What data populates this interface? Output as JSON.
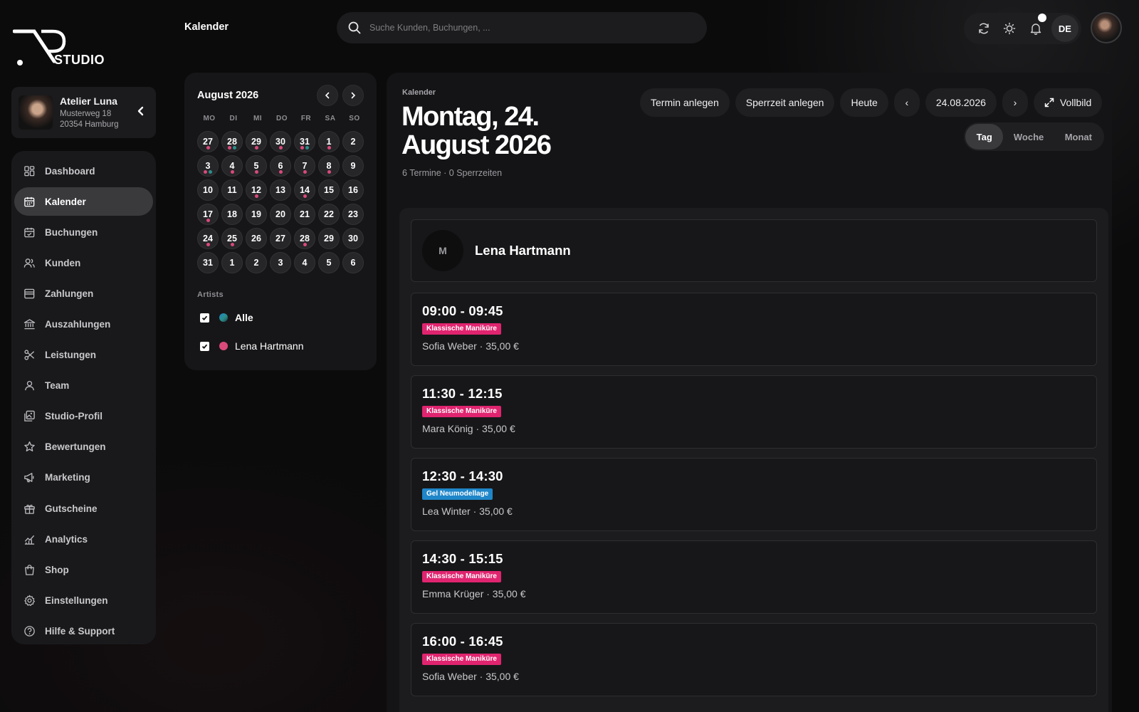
{
  "brand": {
    "name": "STUDIO"
  },
  "studio": {
    "name": "Atelier Luna",
    "street": "Musterweg 18",
    "city": "20354 Hamburg"
  },
  "nav": {
    "items": [
      {
        "label": "Dashboard",
        "icon": "dashboard-icon"
      },
      {
        "label": "Kalender",
        "icon": "calendar-icon",
        "active": true
      },
      {
        "label": "Buchungen",
        "icon": "bookings-icon"
      },
      {
        "label": "Kunden",
        "icon": "customers-icon"
      },
      {
        "label": "Zahlungen",
        "icon": "payments-icon"
      },
      {
        "label": "Auszahlungen",
        "icon": "bank-icon"
      },
      {
        "label": "Leistungen",
        "icon": "scissors-icon"
      },
      {
        "label": "Team",
        "icon": "team-icon"
      },
      {
        "label": "Studio-Profil",
        "icon": "gallery-icon"
      },
      {
        "label": "Bewertungen",
        "icon": "star-icon"
      },
      {
        "label": "Marketing",
        "icon": "megaphone-icon"
      },
      {
        "label": "Gutscheine",
        "icon": "gift-icon"
      },
      {
        "label": "Analytics",
        "icon": "chart-icon"
      },
      {
        "label": "Shop",
        "icon": "shop-icon"
      },
      {
        "label": "Einstellungen",
        "icon": "settings-icon"
      },
      {
        "label": "Hilfe & Support",
        "icon": "help-icon"
      }
    ]
  },
  "header": {
    "title": "Kalender",
    "search_placeholder": "Suche Kunden, Buchungen, ...",
    "language": "DE"
  },
  "mini_calendar": {
    "month": "August 2026",
    "weekdays": [
      "MO",
      "DI",
      "MI",
      "DO",
      "FR",
      "SA",
      "SO"
    ],
    "days": [
      {
        "n": "27",
        "dots": [
          "#d94a7a"
        ]
      },
      {
        "n": "28",
        "dots": [
          "#d94a7a",
          "#2a8f8a"
        ]
      },
      {
        "n": "29",
        "dots": [
          "#d94a7a"
        ]
      },
      {
        "n": "30",
        "dots": [
          "#d94a7a"
        ]
      },
      {
        "n": "31",
        "dots": [
          "#d94a7a",
          "#2a8f8a"
        ]
      },
      {
        "n": "1",
        "dots": [
          "#d94a7a"
        ]
      },
      {
        "n": "2",
        "dots": []
      },
      {
        "n": "3",
        "dots": [
          "#d94a7a",
          "#2a8f8a"
        ]
      },
      {
        "n": "4",
        "dots": [
          "#d94a7a"
        ]
      },
      {
        "n": "5",
        "dots": [
          "#d94a7a"
        ]
      },
      {
        "n": "6",
        "dots": [
          "#d94a7a"
        ]
      },
      {
        "n": "7",
        "dots": [
          "#d94a7a"
        ]
      },
      {
        "n": "8",
        "dots": [
          "#d94a7a"
        ]
      },
      {
        "n": "9",
        "dots": []
      },
      {
        "n": "10",
        "dots": []
      },
      {
        "n": "11",
        "dots": []
      },
      {
        "n": "12",
        "dots": [
          "#d94a7a"
        ]
      },
      {
        "n": "13",
        "dots": []
      },
      {
        "n": "14",
        "dots": [
          "#d94a7a"
        ]
      },
      {
        "n": "15",
        "dots": []
      },
      {
        "n": "16",
        "dots": []
      },
      {
        "n": "17",
        "dots": [
          "#d94a7a"
        ]
      },
      {
        "n": "18",
        "dots": []
      },
      {
        "n": "19",
        "dots": []
      },
      {
        "n": "20",
        "dots": []
      },
      {
        "n": "21",
        "dots": []
      },
      {
        "n": "22",
        "dots": []
      },
      {
        "n": "23",
        "dots": []
      },
      {
        "n": "24",
        "dots": [
          "#d94a7a"
        ]
      },
      {
        "n": "25",
        "dots": [
          "#d94a7a"
        ]
      },
      {
        "n": "26",
        "dots": []
      },
      {
        "n": "27",
        "dots": []
      },
      {
        "n": "28",
        "dots": [
          "#d94a7a"
        ]
      },
      {
        "n": "29",
        "dots": []
      },
      {
        "n": "30",
        "dots": []
      },
      {
        "n": "31",
        "dots": []
      },
      {
        "n": "1",
        "dots": []
      },
      {
        "n": "2",
        "dots": []
      },
      {
        "n": "3",
        "dots": []
      },
      {
        "n": "4",
        "dots": []
      },
      {
        "n": "5",
        "dots": []
      },
      {
        "n": "6",
        "dots": []
      }
    ],
    "artists_label": "Artists",
    "artists": [
      {
        "name": "Alle",
        "color": "gradient",
        "checked": true
      },
      {
        "name": "Lena Hartmann",
        "color": "#d94a7a",
        "checked": true
      }
    ]
  },
  "day_view": {
    "breadcrumb": "Kalender",
    "title": "Montag, 24. August 2026",
    "summary": "6 Termine · 0 Sperrzeiten",
    "toolbar": {
      "new_appointment": "Termin anlegen",
      "new_block": "Sperrzeit anlegen",
      "today": "Heute",
      "prev": "‹",
      "date": "24.08.2026",
      "next": "›",
      "fullscreen": "Vollbild"
    },
    "views": [
      {
        "label": "Tag",
        "active": true
      },
      {
        "label": "Woche"
      },
      {
        "label": "Monat"
      }
    ],
    "artist": {
      "initial": "M",
      "name": "Lena Hartmann"
    },
    "appointments": [
      {
        "time": "09:00 - 09:45",
        "service": "Klassische Maniküre",
        "service_color": "#e0246f",
        "meta": "Sofia Weber · 35,00 €"
      },
      {
        "time": "11:30 - 12:15",
        "service": "Klassische Maniküre",
        "service_color": "#e0246f",
        "meta": "Mara König · 35,00 €"
      },
      {
        "time": "12:30 - 14:30",
        "service": "Gel Neumodellage",
        "service_color": "#1f86c9",
        "meta": "Lea Winter · 35,00 €"
      },
      {
        "time": "14:30 - 15:15",
        "service": "Klassische Maniküre",
        "service_color": "#e0246f",
        "meta": "Emma Krüger · 35,00 €"
      },
      {
        "time": "16:00 - 16:45",
        "service": "Klassische Maniküre",
        "service_color": "#e0246f",
        "meta": "Sofia Weber · 35,00 €"
      }
    ]
  }
}
